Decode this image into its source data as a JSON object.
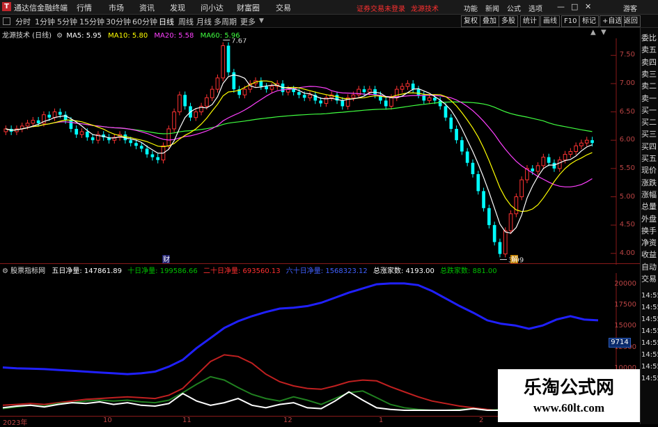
{
  "titlebar": {
    "app_name": "通达信金融终端",
    "menu": [
      "行情",
      "市场",
      "资讯",
      "发现",
      "问小达",
      "财富圈",
      "交易"
    ],
    "warning": "证券交易未登录",
    "brand": "龙源技术",
    "right_menu": [
      "功能",
      "新闻",
      "公式",
      "选项"
    ],
    "user": "游客"
  },
  "periodbar": {
    "periods": [
      "分时",
      "1分钟",
      "5分钟",
      "15分钟",
      "30分钟",
      "60分钟",
      "日线",
      "周线",
      "月线",
      "多周期",
      "更多"
    ],
    "active": "日线",
    "tools": [
      "复权",
      "叠加",
      "多股",
      "统计",
      "画线",
      "F10",
      "标记",
      "+自选",
      "返回"
    ]
  },
  "main_chart": {
    "title": "龙源技术 (日线)",
    "ma_labels": [
      {
        "text": "MA5: 5.95",
        "color": "#ffffff"
      },
      {
        "text": "MA10: 5.80",
        "color": "#ffff00"
      },
      {
        "text": "MA20: 5.58",
        "color": "#ff40ff"
      },
      {
        "text": "MA60: 5.96",
        "color": "#40ff40"
      }
    ],
    "high_label": "7.67",
    "low_label": "3.99",
    "marker_cai": "财",
    "marker_jie": "解",
    "y_ticks": [
      "7.50",
      "7.00",
      "6.50",
      "6.00",
      "5.50",
      "5.00",
      "4.50",
      "4.00"
    ],
    "colors": {
      "up": "#ff3232",
      "down": "#00ffff",
      "ma5": "#ffffff",
      "ma10": "#ffff00",
      "ma20": "#ff40ff",
      "ma60": "#40ff40"
    }
  },
  "sub_chart": {
    "name": "股票指标网",
    "labels": [
      {
        "text": "五日净量: 147861.89",
        "color": "#ffffff"
      },
      {
        "text": "十日净量: 199586.66",
        "color": "#00c000"
      },
      {
        "text": "二十日净量: 693560.13",
        "color": "#ff3030"
      },
      {
        "text": "六十日净量: 1568323.12",
        "color": "#4060ff"
      },
      {
        "text": "总涨家数: 4193.00",
        "color": "#ffffff"
      },
      {
        "text": "总跌家数: 881.00",
        "color": "#00c000"
      }
    ],
    "y_ticks": [
      "20000",
      "17500",
      "15000",
      "12500",
      "10000",
      "7500"
    ],
    "value_box": "9714",
    "x_ticks": [
      "2023年",
      "10",
      "11",
      "12",
      "1",
      "2"
    ]
  },
  "right_panel": {
    "labels": [
      "委比",
      "卖五",
      "卖四",
      "卖三",
      "卖二",
      "卖一",
      "买一",
      "买二",
      "买三",
      "买四",
      "买五",
      "现价",
      "涨跌",
      "涨幅",
      "总量",
      "外盘",
      "换手",
      "净资",
      "收益",
      "自动",
      "交易"
    ],
    "times": [
      "14:55",
      "14:55",
      "14:55",
      "14:55",
      "14:55",
      "14:55",
      "14:55",
      "14:55"
    ]
  },
  "watermark": {
    "title": "乐淘公式网",
    "url": "www.60lt.com"
  },
  "chart_data": [
    {
      "type": "candlestick",
      "title": "龙源技术 (日线)",
      "ylim": [
        3.8,
        7.8
      ],
      "x_labels": [
        "2023年",
        "10",
        "11",
        "12",
        "1",
        "2"
      ],
      "series": [
        {
          "name": "MA5",
          "value_last": 5.95
        },
        {
          "name": "MA10",
          "value_last": 5.8
        },
        {
          "name": "MA20",
          "value_last": 5.58
        },
        {
          "name": "MA60",
          "value_last": 5.96
        }
      ],
      "close": [
        6.2,
        6.15,
        6.2,
        6.25,
        6.3,
        6.35,
        6.3,
        6.45,
        6.4,
        6.5,
        6.45,
        6.35,
        6.2,
        6.1,
        6.15,
        6.05,
        6.0,
        6.1,
        6.05,
        6.0,
        6.05,
        6.1,
        6.0,
        5.95,
        5.9,
        5.85,
        5.75,
        5.7,
        5.65,
        5.9,
        6.2,
        6.5,
        6.8,
        6.6,
        6.4,
        6.5,
        6.6,
        6.75,
        6.9,
        7.1,
        7.67,
        7.2,
        6.9,
        6.8,
        6.9,
        7.0,
        7.05,
        6.95,
        6.9,
        6.95,
        7.0,
        6.85,
        6.9,
        6.85,
        6.8,
        6.75,
        6.8,
        6.7,
        6.65,
        6.75,
        6.8,
        6.7,
        6.6,
        6.75,
        6.8,
        6.9,
        6.85,
        6.9,
        6.8,
        6.7,
        6.6,
        6.75,
        6.9,
        6.95,
        7.0,
        6.9,
        6.8,
        6.7,
        6.75,
        6.7,
        6.6,
        6.4,
        6.2,
        6.0,
        5.8,
        5.6,
        5.4,
        5.1,
        4.8,
        4.5,
        4.2,
        3.99,
        4.4,
        4.7,
        5.0,
        5.3,
        5.5,
        5.45,
        5.55,
        5.7,
        5.6,
        5.5,
        5.65,
        5.75,
        5.8,
        5.9,
        5.95,
        6.0,
        5.95
      ],
      "high_annotation": 7.67,
      "low_annotation": 3.99
    },
    {
      "type": "line",
      "title": "股票指标网",
      "ylim": [
        5000,
        21000
      ],
      "series": [
        {
          "name": "六十日净量",
          "color": "#2020ff"
        },
        {
          "name": "二十日净量",
          "color": "#c02020"
        },
        {
          "name": "十日净量",
          "color": "#208020"
        },
        {
          "name": "五日净量",
          "color": "#ffffff"
        }
      ]
    }
  ]
}
